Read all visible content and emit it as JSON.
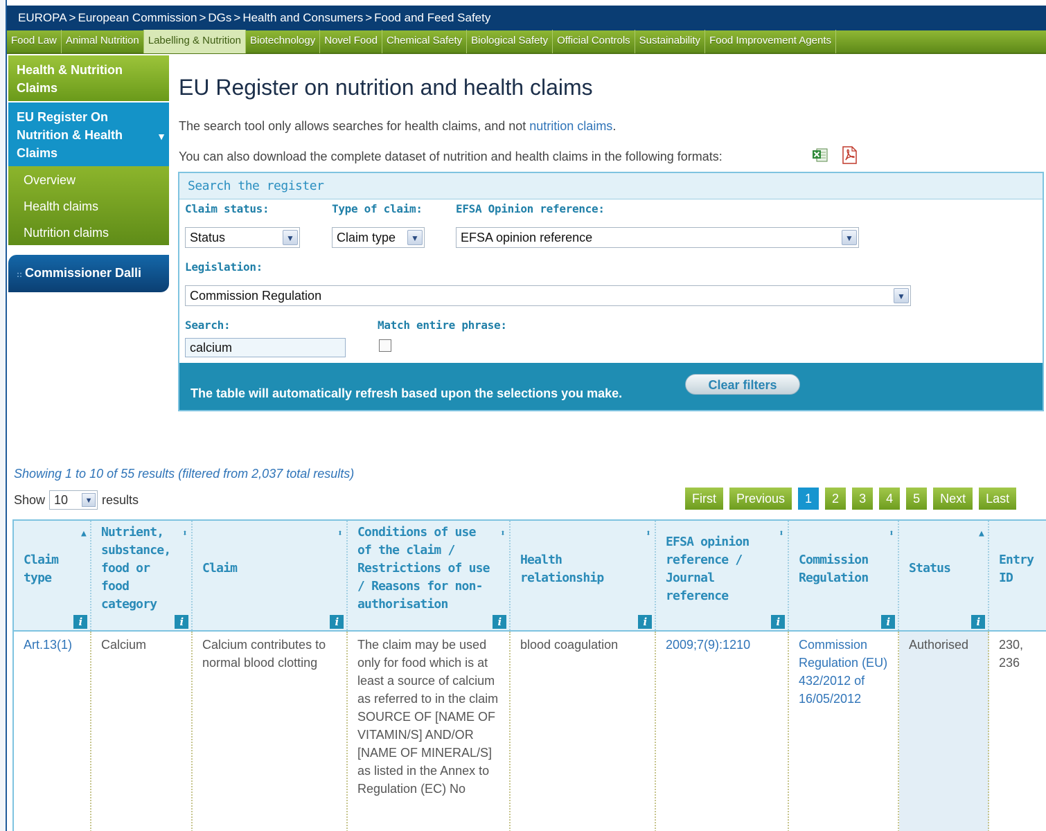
{
  "breadcrumb": [
    "EUROPA",
    "European Commission",
    "DGs",
    "Health and Consumers",
    "Food and Feed Safety"
  ],
  "breadcrumb_separator": ">",
  "top_nav": [
    {
      "label": "Food Law",
      "active": false
    },
    {
      "label": "Animal Nutrition",
      "active": false
    },
    {
      "label": "Labelling & Nutrition",
      "active": true
    },
    {
      "label": "Biotechnology",
      "active": false
    },
    {
      "label": "Novel Food",
      "active": false
    },
    {
      "label": "Chemical Safety",
      "active": false
    },
    {
      "label": "Biological Safety",
      "active": false
    },
    {
      "label": "Official Controls",
      "active": false
    },
    {
      "label": "Sustainability",
      "active": false
    },
    {
      "label": "Food Improvement Agents",
      "active": false
    }
  ],
  "sidebar": {
    "section_title": "Health & Nutrition Claims",
    "current": "EU Register On Nutrition & Health Claims",
    "items": [
      "Overview",
      "Health claims",
      "Nutrition claims"
    ],
    "commissioner": "Commissioner Dalli"
  },
  "main": {
    "title": "EU Register on nutrition and health claims",
    "intro_prefix": "The search tool only allows searches for health claims, and not ",
    "intro_link": "nutrition claims",
    "intro_suffix": ".",
    "download_text": "You can also download the complete dataset of nutrition and health claims in the following formats:",
    "download_icons": [
      "excel-icon",
      "pdf-icon"
    ]
  },
  "search_panel": {
    "title": "Search the register",
    "claim_status_label": "Claim status:",
    "claim_status_value": "Status",
    "claim_type_label": "Type of claim:",
    "claim_type_value": "Claim type",
    "efsa_label": "EFSA Opinion reference:",
    "efsa_value": "EFSA opinion reference",
    "legislation_label": "Legislation:",
    "legislation_value": "Commission Regulation",
    "search_label": "Search:",
    "search_value": "calcium",
    "match_label": "Match entire phrase:",
    "match_checked": false,
    "footer_text": "The table will automatically refresh based upon the selections you make.",
    "clear_button": "Clear filters"
  },
  "results": {
    "showing": "Showing 1 to 10 of 55 results (filtered from 2,037 total results)",
    "show_label": "Show",
    "page_length": "10",
    "results_label": "results",
    "pager": {
      "first": "First",
      "previous": "Previous",
      "pages": [
        "1",
        "2",
        "3",
        "4",
        "5"
      ],
      "current_page": "1",
      "next": "Next",
      "last": "Last"
    }
  },
  "table": {
    "columns": [
      "Claim type",
      "Nutrient, substance, food or food category",
      "Claim",
      "Conditions of use of the claim / Restrictions of use / Reasons for non-authorisation",
      "Health relationship",
      "EFSA opinion reference / Journal reference",
      "Commission Regulation",
      "Status",
      "Entry ID"
    ],
    "rows": [
      {
        "claim_type": "Art.13(1)",
        "nutrient": "Calcium",
        "claim": "Calcium contributes to normal blood clotting",
        "conditions": "The claim may be used only for food which is at least a source of calcium as referred to in the claim SOURCE OF [NAME OF VITAMIN/S] AND/OR [NAME OF MINERAL/S] as listed in the Annex to Regulation (EC) No",
        "health_relationship": "blood coagulation",
        "efsa_reference": "2009;7(9):1210",
        "commission_regulation": "Commission Regulation (EU) 432/2012 of 16/05/2012",
        "status": "Authorised",
        "entry_id": "230, 236"
      }
    ]
  },
  "colors": {
    "breadcrumb_bg": "#0a3d73",
    "nav_green": "#6e9d1f",
    "sidebar_blue": "#1493c8",
    "panel_accent": "#1f8db3",
    "link": "#2f74b8"
  }
}
